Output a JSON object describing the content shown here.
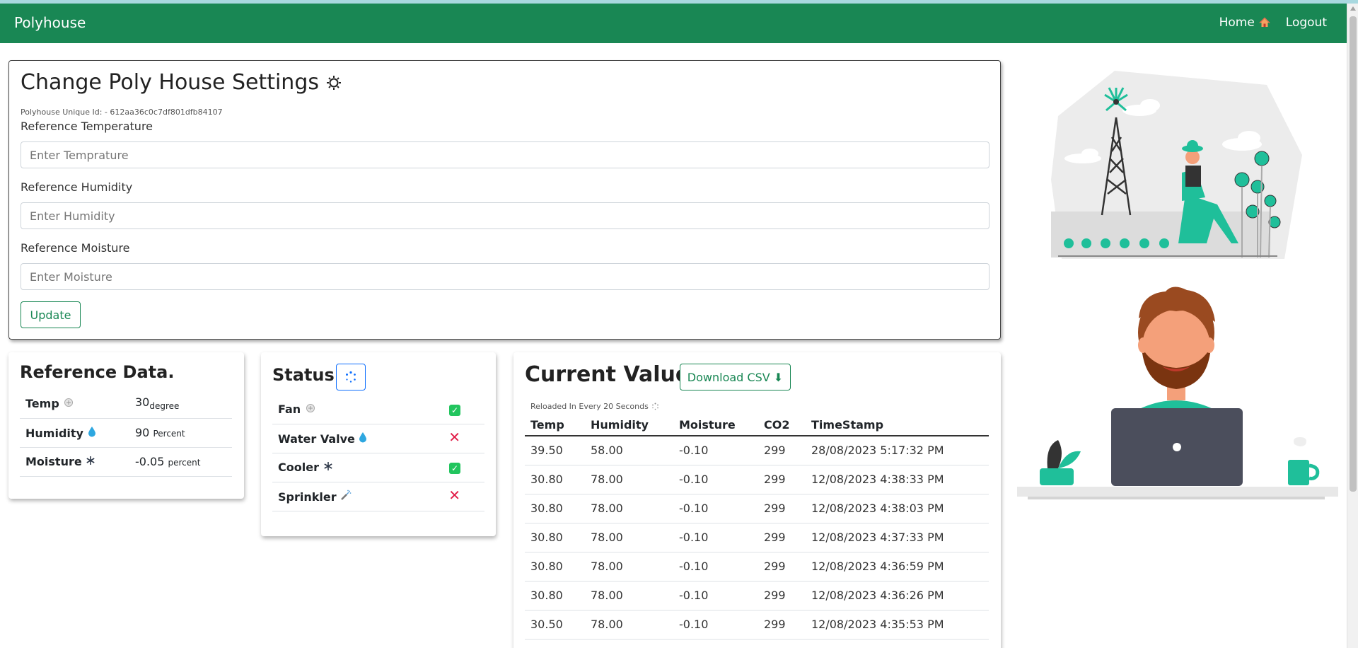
{
  "navbar": {
    "brand": "Polyhouse",
    "home_label": "Home",
    "logout_label": "Logout"
  },
  "settings": {
    "title": "Change Poly House Settings",
    "uid_label": "Polyhouse Unique Id: - 612aa36c0c7df801dfb84107",
    "temp_label": "Reference Temperature",
    "temp_placeholder": "Enter Temprature",
    "temp_value": "",
    "humidity_label": "Reference Humidity",
    "humidity_placeholder": "Enter Humidity",
    "humidity_value": "",
    "moisture_label": "Reference Moisture",
    "moisture_placeholder": "Enter Moisture",
    "moisture_value": "",
    "update_label": "Update"
  },
  "reference": {
    "title": "Reference Data.",
    "rows": [
      {
        "label": "Temp",
        "value": "30",
        "unit": "degree",
        "icon": "thermometer-icon"
      },
      {
        "label": "Humidity",
        "value": "90",
        "unit": "Percent",
        "icon": "droplet-icon"
      },
      {
        "label": "Moisture",
        "value": "-0.05",
        "unit": "percent",
        "icon": "snowflake-icon"
      }
    ]
  },
  "status": {
    "title": "Status:",
    "rows": [
      {
        "label": "Fan",
        "state": "on",
        "icon": "fan-icon"
      },
      {
        "label": "Water Valve",
        "state": "off",
        "icon": "droplet-icon"
      },
      {
        "label": "Cooler",
        "state": "on",
        "icon": "snowflake-icon"
      },
      {
        "label": "Sprinkler",
        "state": "off",
        "icon": "sprinkler-icon"
      }
    ]
  },
  "current": {
    "title": "Current Values",
    "csv_label": "Download CSV",
    "reload_note": "Reloaded In Every 20 Seconds",
    "columns": [
      "Temp",
      "Humidity",
      "Moisture",
      "CO2",
      "TimeStamp"
    ],
    "rows": [
      [
        "39.50",
        "58.00",
        "-0.10",
        "299",
        "28/08/2023 5:17:32 PM"
      ],
      [
        "30.80",
        "78.00",
        "-0.10",
        "299",
        "12/08/2023 4:38:33 PM"
      ],
      [
        "30.80",
        "78.00",
        "-0.10",
        "299",
        "12/08/2023 4:38:03 PM"
      ],
      [
        "30.80",
        "78.00",
        "-0.10",
        "299",
        "12/08/2023 4:37:33 PM"
      ],
      [
        "30.80",
        "78.00",
        "-0.10",
        "299",
        "12/08/2023 4:36:59 PM"
      ],
      [
        "30.80",
        "78.00",
        "-0.10",
        "299",
        "12/08/2023 4:36:26 PM"
      ],
      [
        "30.50",
        "78.00",
        "-0.10",
        "299",
        "12/08/2023 4:35:53 PM"
      ]
    ]
  },
  "colors": {
    "brand_green": "#198754",
    "accent_teal": "#1fbf9a",
    "check_green": "#22c55e",
    "cross_red": "#e11d48",
    "spinner_blue": "#0d6efd"
  }
}
